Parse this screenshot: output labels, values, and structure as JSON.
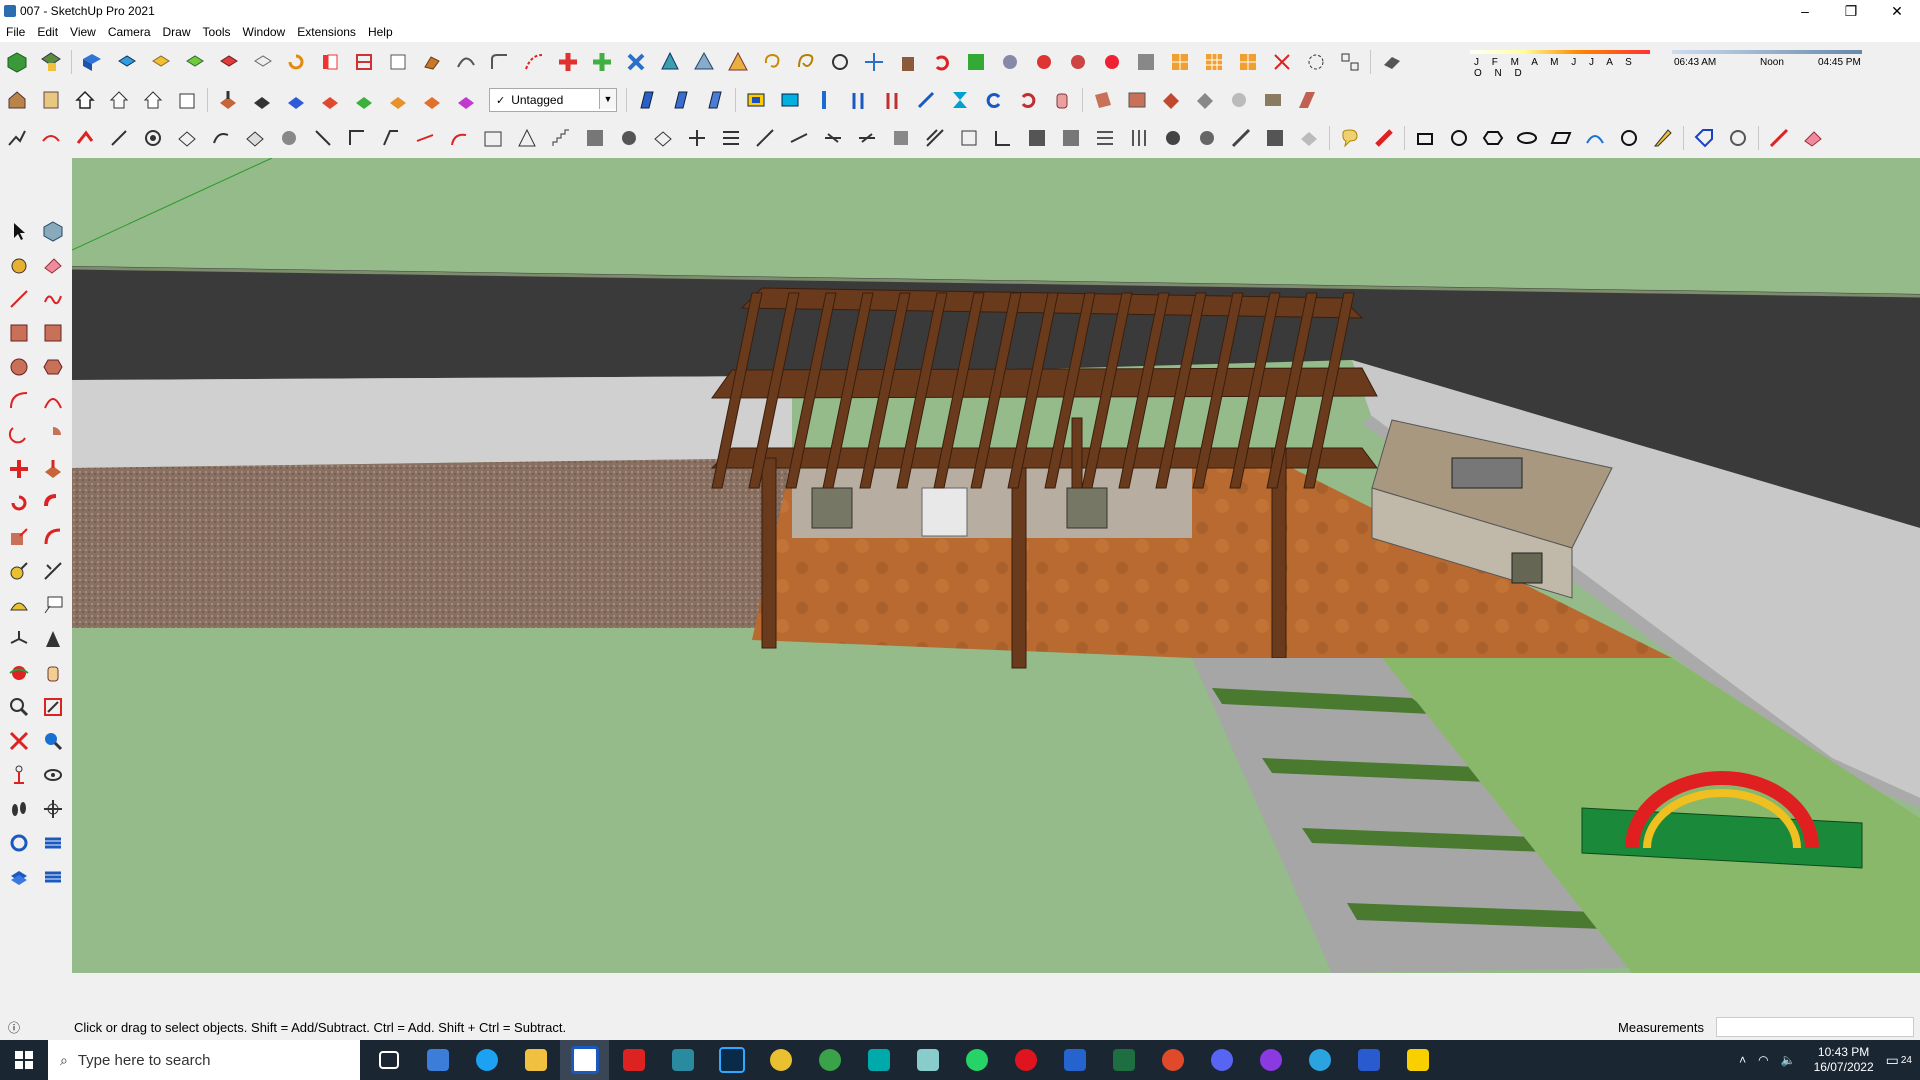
{
  "window": {
    "title": "007 - SketchUp Pro 2021",
    "controls": [
      "–",
      "❐",
      "✕"
    ]
  },
  "menu": [
    "File",
    "Edit",
    "View",
    "Camera",
    "Draw",
    "Tools",
    "Window",
    "Extensions",
    "Help"
  ],
  "tag_select": {
    "check": "✓",
    "value": "Untagged"
  },
  "shadow": {
    "months": "J F M A M J J A S O N D",
    "time_start": "06:43 AM",
    "time_mid": "Noon",
    "time_end": "04:45 PM"
  },
  "status": {
    "help_text": "Click or drag to select objects. Shift = Add/Subtract. Ctrl = Add. Shift + Ctrl = Subtract.",
    "measurements_label": "Measurements"
  },
  "taskbar": {
    "search_placeholder": "Type here to search",
    "time": "10:43 PM",
    "date": "16/07/2022",
    "notifications": "24"
  },
  "colors": {
    "grass": "#95bb8a",
    "road": "#3a3a3a",
    "timber": "#6a3a1c",
    "patio": "#b86a30"
  }
}
